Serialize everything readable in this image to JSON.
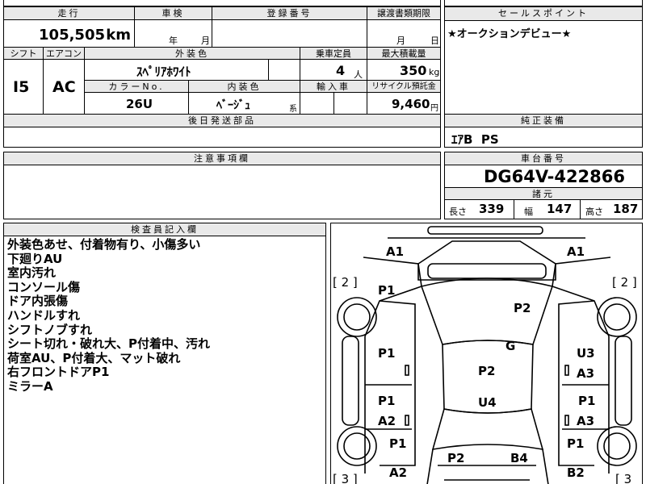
{
  "header": {
    "mileage_label": "走行",
    "inspection_label": "車検",
    "registration_label": "登録番号",
    "transfer_deadline_label": "譲渡書類期限",
    "year_label": "年",
    "month_label": "月",
    "day_label": "日",
    "mileage_value": "105,505",
    "mileage_unit": "km"
  },
  "row2": {
    "shift_label": "シフト",
    "ac_label": "エアコン",
    "exterior_color_label": "外装色",
    "capacity_label": "乗車定員",
    "max_load_label": "最大積載量",
    "shift_value": "I5",
    "ac_value": "AC",
    "exterior_color_value": "ｽﾍﾟﾘｱﾎﾜｲﾄ",
    "capacity_value": "4",
    "capacity_unit": "人",
    "max_load_value": "350",
    "max_load_unit": "kg",
    "color_no_label": "カラーNo.",
    "interior_color_label": "内装色",
    "import_label": "輸入車",
    "recycle_label": "リサイクル預託金",
    "color_no_value": "26U",
    "interior_color_value": "ﾍﾞｰｼﾞｭ",
    "interior_suffix": "系",
    "recycle_value": "9,460",
    "recycle_unit": "円"
  },
  "later_parts": {
    "label": "後日発送部品"
  },
  "caution": {
    "label": "注意事項欄"
  },
  "sales_point": {
    "label": "セールスポイント",
    "text": "★オークションデビュー★"
  },
  "standard_equipment": {
    "label": "純正装備",
    "value": "ｴｱB  PS"
  },
  "chassis": {
    "label": "車台番号",
    "value": "DG64V-422866",
    "specs_label": "諸元",
    "length_label": "長さ",
    "length_value": "339",
    "width_label": "幅",
    "width_value": "147",
    "height_label": "高さ",
    "height_value": "187"
  },
  "inspector": {
    "label": "検査員記入欄",
    "notes": [
      "外装色あせ、付着物有り、小傷多い",
      "下廻りAU",
      "室内汚れ",
      "コンソール傷",
      "ドア内張傷",
      "ハンドルすれ",
      "シフトノブすれ",
      "シート切れ・破れ大、P付着中、汚れ",
      "荷室AU、P付着大、マット破れ",
      "右フロントドアP1",
      "ミラーA"
    ]
  },
  "diagram": {
    "marks": [
      {
        "id": "a1-left",
        "text": "A1"
      },
      {
        "id": "a1-right",
        "text": "A1"
      },
      {
        "id": "bracket-left-top",
        "text": "[ 2 ]"
      },
      {
        "id": "bracket-right-top",
        "text": "[ 2 ]"
      },
      {
        "id": "p1-front-left",
        "text": "P1"
      },
      {
        "id": "p2-windshield",
        "text": "P2"
      },
      {
        "id": "p1-fender-left",
        "text": "P1"
      },
      {
        "id": "g-roof",
        "text": "G"
      },
      {
        "id": "u3-right",
        "text": "U3"
      },
      {
        "id": "a3-right-upper",
        "text": "A3"
      },
      {
        "id": "p2-roof",
        "text": "P2"
      },
      {
        "id": "u4-roof",
        "text": "U4"
      },
      {
        "id": "p1-door-left",
        "text": "P1"
      },
      {
        "id": "a2-door-left",
        "text": "A2"
      },
      {
        "id": "p1-door-right",
        "text": "P1"
      },
      {
        "id": "a3-door-right",
        "text": "A3"
      },
      {
        "id": "p1-rear-left",
        "text": "P1"
      },
      {
        "id": "p1-rear-right",
        "text": "P1"
      },
      {
        "id": "p2-rear",
        "text": "P2"
      },
      {
        "id": "b4-rear",
        "text": "B4"
      },
      {
        "id": "a2-rear-left",
        "text": "A2"
      },
      {
        "id": "b2-rear-right",
        "text": "B2"
      },
      {
        "id": "bracket-left-bottom",
        "text": "[ 3 ]"
      },
      {
        "id": "bracket-right-bottom",
        "text": "[ 3"
      }
    ]
  }
}
